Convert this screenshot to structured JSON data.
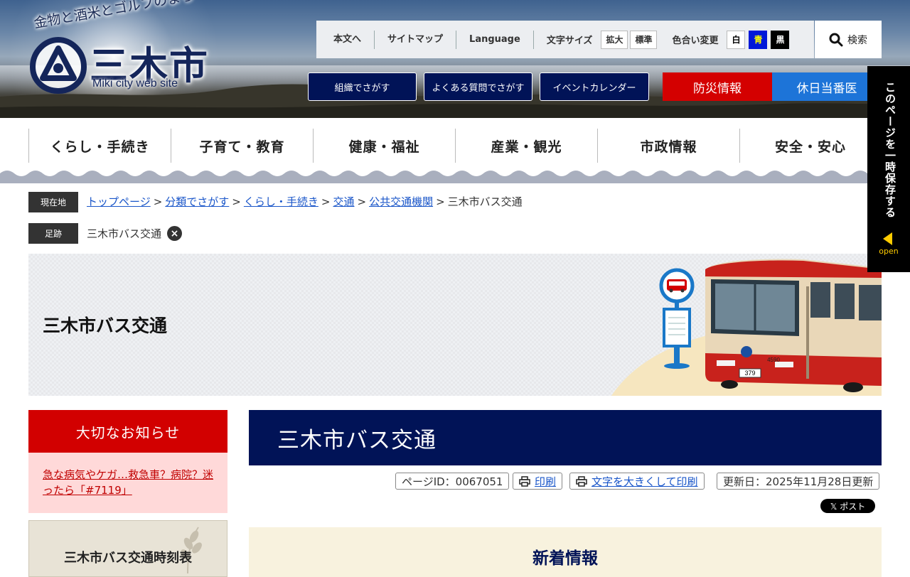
{
  "header": {
    "tagline": "金物と酒米とゴルフのまち",
    "city_name": "三木市",
    "web_text": "Miki city web site",
    "util": {
      "skip_link": "本文へ",
      "sitemap": "サイトマップ",
      "language": "Language",
      "font_size_label": "文字サイズ",
      "font_large": "拡大",
      "font_normal": "標準",
      "color_label": "色合い変更",
      "color_white": "白",
      "color_blue": "青",
      "color_black": "黒",
      "search": "検索"
    },
    "nav_buttons": [
      "組織でさがす",
      "よくある質問でさがす",
      "イベントカレンダー"
    ],
    "disaster": "防災情報",
    "holiday": "休日当番医"
  },
  "global_nav": [
    "くらし・手続き",
    "子育て・教育",
    "健康・福祉",
    "産業・観光",
    "市政情報",
    "安全・安心"
  ],
  "breadcrumb": {
    "current_label": "現在地",
    "links": [
      "トップページ",
      "分類でさがす",
      "くらし・手続き",
      "交通",
      "公共交通機関"
    ],
    "separator": ">",
    "current": "三木市バス交通"
  },
  "footprint": {
    "label": "足跡",
    "item": "三木市バス交通",
    "remove": "×"
  },
  "banner": {
    "title": "三木市バス交通",
    "bus_number": "4590",
    "plate": "379"
  },
  "sidebar": {
    "notice_title": "大切なお知らせ",
    "notice_link": "急な病気やケガ…救急車？病院？迷ったら「#7119」",
    "box_title": "三木市バス交通時刻表"
  },
  "main": {
    "title": "三木市バス交通",
    "page_id": "ページID：0067051",
    "print": "印刷",
    "print_large": "文字を大きくして印刷",
    "updated": "更新日：2025年11月28日更新",
    "x_post": "𝕏 ポスト",
    "news_title": "新着情報"
  },
  "side_tab": {
    "text": "このページを一時保存する",
    "open": "open"
  },
  "colors": {
    "navy": "#011357",
    "red": "#d40000",
    "blue": "#1d74d8",
    "link": "#1a56c9",
    "notice_bg": "#ffd9d9",
    "news_bg": "#f8f2de"
  }
}
